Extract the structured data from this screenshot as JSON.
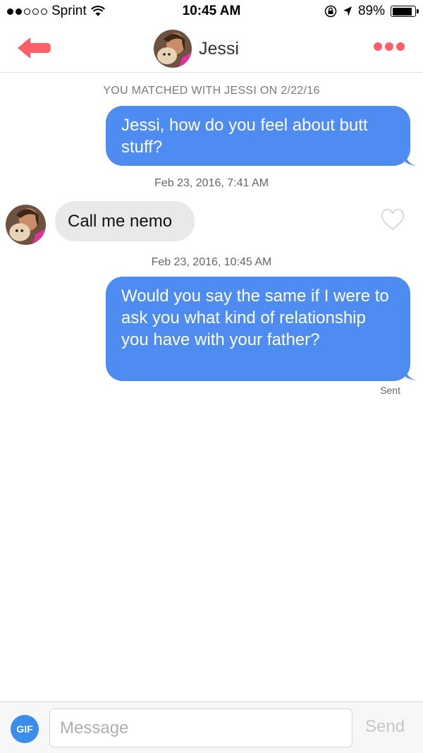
{
  "status_bar": {
    "carrier": "Sprint",
    "time": "10:45 AM",
    "battery": "89%",
    "battery_level": 0.89,
    "signal_bars": 2
  },
  "header": {
    "back_icon": "back-arrow-icon",
    "contact_name": "Jessi",
    "more_icon": "more-dots-icon",
    "accent_color": "#fb5f6a"
  },
  "conversation": {
    "match_text": "YOU MATCHED WITH JESSI ON 2/22/16",
    "messages": [
      {
        "direction": "outgoing",
        "text": "Jessi, how do you feel about butt stuff?"
      },
      {
        "timestamp": "Feb 23, 2016, 7:41 AM"
      },
      {
        "direction": "incoming",
        "text": "Call me nemo"
      },
      {
        "timestamp": "Feb 23, 2016, 10:45 AM"
      },
      {
        "direction": "outgoing",
        "text": "Would you say the same if I were to ask you what kind of relationship you have with your father?"
      }
    ],
    "sent_label": "Sent",
    "outgoing_color": "#4e8cf2",
    "incoming_color": "#e9e9eb"
  },
  "composer": {
    "gif_label": "GIF",
    "placeholder": "Message",
    "send_label": "Send"
  }
}
